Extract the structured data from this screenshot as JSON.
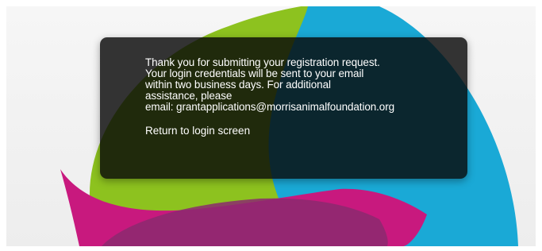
{
  "background": {
    "colors": {
      "panel": "#f0f0f0",
      "green": "#8dc21f",
      "blue": "#1aa9d6",
      "magenta": "#c8197e",
      "purple": "#8b2a6e"
    }
  },
  "dialog": {
    "message_lines": [
      "Thank you for submitting your registration request.",
      "Your login credentials will be sent to your email",
      "within two business days. For additional",
      "assistance, please",
      "email: grantapplications@morrisanimalfoundation.org"
    ],
    "return_link_label": "Return to login screen",
    "colors": {
      "background": "#0b0b0b",
      "text": "#ffffff"
    }
  }
}
